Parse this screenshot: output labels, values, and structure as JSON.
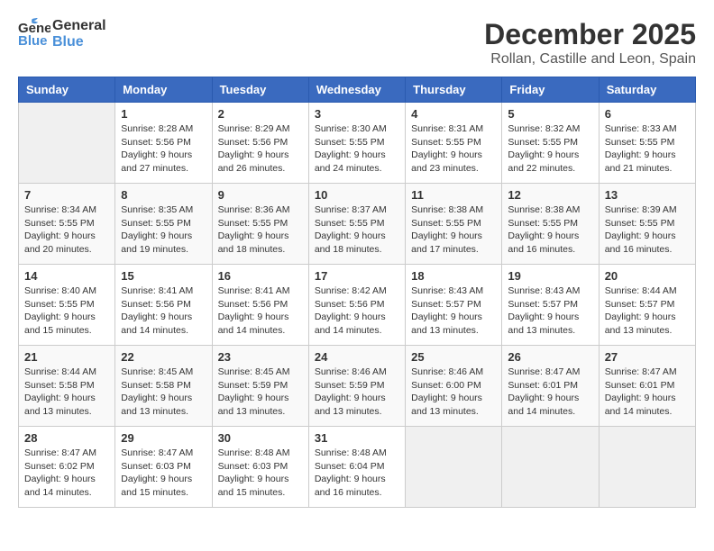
{
  "header": {
    "logo_line1": "General",
    "logo_line2": "Blue",
    "month": "December 2025",
    "location": "Rollan, Castille and Leon, Spain"
  },
  "days_of_week": [
    "Sunday",
    "Monday",
    "Tuesday",
    "Wednesday",
    "Thursday",
    "Friday",
    "Saturday"
  ],
  "weeks": [
    [
      {
        "day": "",
        "info": ""
      },
      {
        "day": "1",
        "info": "Sunrise: 8:28 AM\nSunset: 5:56 PM\nDaylight: 9 hours\nand 27 minutes."
      },
      {
        "day": "2",
        "info": "Sunrise: 8:29 AM\nSunset: 5:56 PM\nDaylight: 9 hours\nand 26 minutes."
      },
      {
        "day": "3",
        "info": "Sunrise: 8:30 AM\nSunset: 5:55 PM\nDaylight: 9 hours\nand 24 minutes."
      },
      {
        "day": "4",
        "info": "Sunrise: 8:31 AM\nSunset: 5:55 PM\nDaylight: 9 hours\nand 23 minutes."
      },
      {
        "day": "5",
        "info": "Sunrise: 8:32 AM\nSunset: 5:55 PM\nDaylight: 9 hours\nand 22 minutes."
      },
      {
        "day": "6",
        "info": "Sunrise: 8:33 AM\nSunset: 5:55 PM\nDaylight: 9 hours\nand 21 minutes."
      }
    ],
    [
      {
        "day": "7",
        "info": "Sunrise: 8:34 AM\nSunset: 5:55 PM\nDaylight: 9 hours\nand 20 minutes."
      },
      {
        "day": "8",
        "info": "Sunrise: 8:35 AM\nSunset: 5:55 PM\nDaylight: 9 hours\nand 19 minutes."
      },
      {
        "day": "9",
        "info": "Sunrise: 8:36 AM\nSunset: 5:55 PM\nDaylight: 9 hours\nand 18 minutes."
      },
      {
        "day": "10",
        "info": "Sunrise: 8:37 AM\nSunset: 5:55 PM\nDaylight: 9 hours\nand 18 minutes."
      },
      {
        "day": "11",
        "info": "Sunrise: 8:38 AM\nSunset: 5:55 PM\nDaylight: 9 hours\nand 17 minutes."
      },
      {
        "day": "12",
        "info": "Sunrise: 8:38 AM\nSunset: 5:55 PM\nDaylight: 9 hours\nand 16 minutes."
      },
      {
        "day": "13",
        "info": "Sunrise: 8:39 AM\nSunset: 5:55 PM\nDaylight: 9 hours\nand 16 minutes."
      }
    ],
    [
      {
        "day": "14",
        "info": "Sunrise: 8:40 AM\nSunset: 5:55 PM\nDaylight: 9 hours\nand 15 minutes."
      },
      {
        "day": "15",
        "info": "Sunrise: 8:41 AM\nSunset: 5:56 PM\nDaylight: 9 hours\nand 14 minutes."
      },
      {
        "day": "16",
        "info": "Sunrise: 8:41 AM\nSunset: 5:56 PM\nDaylight: 9 hours\nand 14 minutes."
      },
      {
        "day": "17",
        "info": "Sunrise: 8:42 AM\nSunset: 5:56 PM\nDaylight: 9 hours\nand 14 minutes."
      },
      {
        "day": "18",
        "info": "Sunrise: 8:43 AM\nSunset: 5:57 PM\nDaylight: 9 hours\nand 13 minutes."
      },
      {
        "day": "19",
        "info": "Sunrise: 8:43 AM\nSunset: 5:57 PM\nDaylight: 9 hours\nand 13 minutes."
      },
      {
        "day": "20",
        "info": "Sunrise: 8:44 AM\nSunset: 5:57 PM\nDaylight: 9 hours\nand 13 minutes."
      }
    ],
    [
      {
        "day": "21",
        "info": "Sunrise: 8:44 AM\nSunset: 5:58 PM\nDaylight: 9 hours\nand 13 minutes."
      },
      {
        "day": "22",
        "info": "Sunrise: 8:45 AM\nSunset: 5:58 PM\nDaylight: 9 hours\nand 13 minutes."
      },
      {
        "day": "23",
        "info": "Sunrise: 8:45 AM\nSunset: 5:59 PM\nDaylight: 9 hours\nand 13 minutes."
      },
      {
        "day": "24",
        "info": "Sunrise: 8:46 AM\nSunset: 5:59 PM\nDaylight: 9 hours\nand 13 minutes."
      },
      {
        "day": "25",
        "info": "Sunrise: 8:46 AM\nSunset: 6:00 PM\nDaylight: 9 hours\nand 13 minutes."
      },
      {
        "day": "26",
        "info": "Sunrise: 8:47 AM\nSunset: 6:01 PM\nDaylight: 9 hours\nand 14 minutes."
      },
      {
        "day": "27",
        "info": "Sunrise: 8:47 AM\nSunset: 6:01 PM\nDaylight: 9 hours\nand 14 minutes."
      }
    ],
    [
      {
        "day": "28",
        "info": "Sunrise: 8:47 AM\nSunset: 6:02 PM\nDaylight: 9 hours\nand 14 minutes."
      },
      {
        "day": "29",
        "info": "Sunrise: 8:47 AM\nSunset: 6:03 PM\nDaylight: 9 hours\nand 15 minutes."
      },
      {
        "day": "30",
        "info": "Sunrise: 8:48 AM\nSunset: 6:03 PM\nDaylight: 9 hours\nand 15 minutes."
      },
      {
        "day": "31",
        "info": "Sunrise: 8:48 AM\nSunset: 6:04 PM\nDaylight: 9 hours\nand 16 minutes."
      },
      {
        "day": "",
        "info": ""
      },
      {
        "day": "",
        "info": ""
      },
      {
        "day": "",
        "info": ""
      }
    ]
  ]
}
